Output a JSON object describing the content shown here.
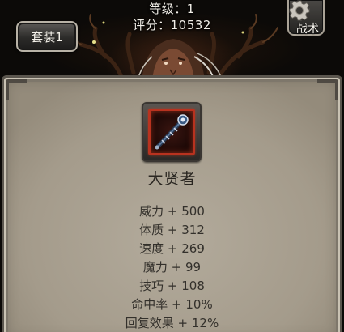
{
  "header": {
    "level_text": "等级：1",
    "score_text": "评分：10532"
  },
  "buttons": {
    "suit_label": "套装1",
    "tactics_label": "战术"
  },
  "icons": {
    "tactics": "gear-icon",
    "item": "staff-icon"
  },
  "item": {
    "name": "大贤者",
    "rarity_color": "#b8321f"
  },
  "stats": [
    "威力 + 500",
    "体质 + 312",
    "速度 + 269",
    "魔力 + 99",
    "技巧 + 108",
    "命中率 + 10%",
    "回复效果 + 12%"
  ]
}
